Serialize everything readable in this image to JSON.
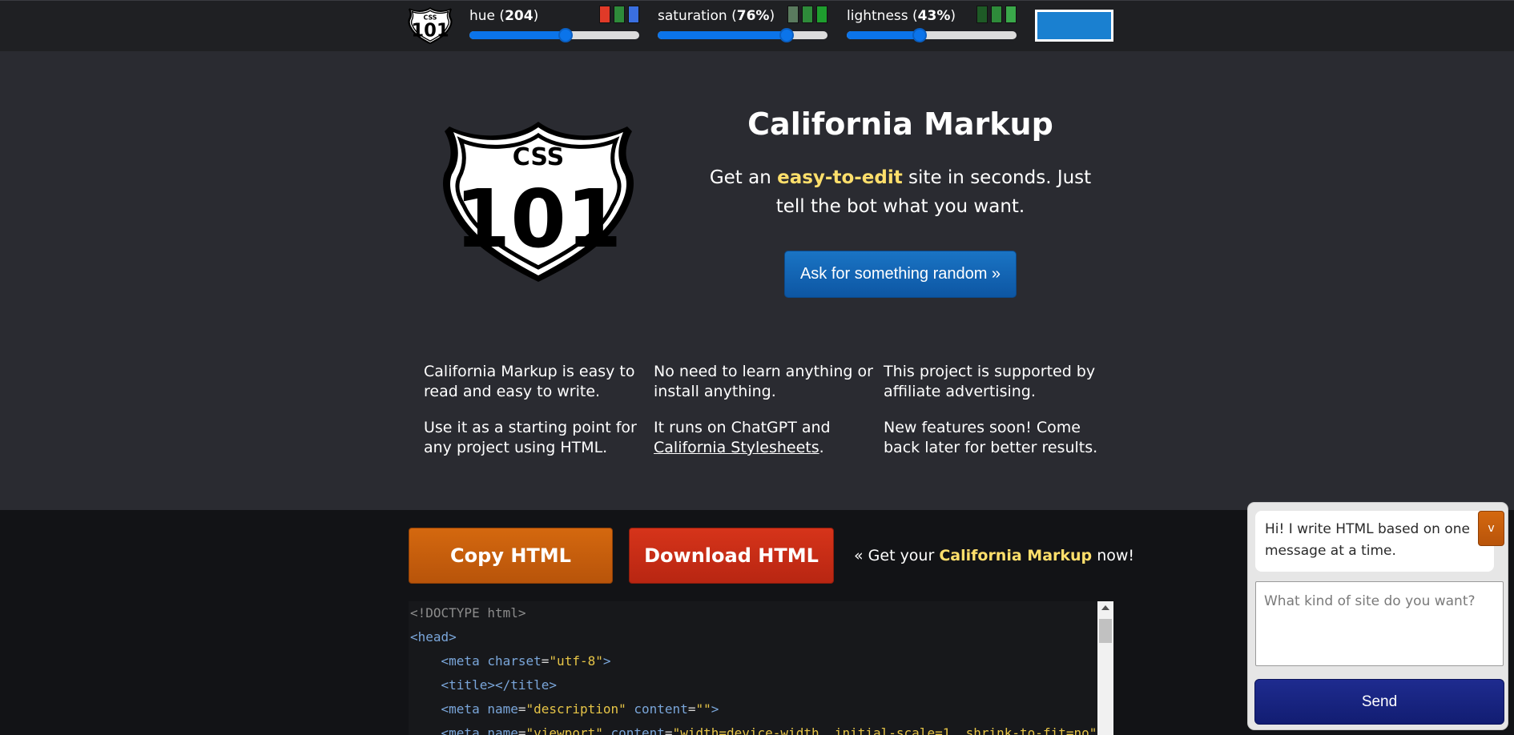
{
  "logo": {
    "top_text": "CSS",
    "number": "101"
  },
  "controls": {
    "hue": {
      "label": "hue",
      "value_text": "204",
      "fraction": 0.567,
      "swatches": [
        "#e03a28",
        "#2e8b3a",
        "#3a6fe0"
      ]
    },
    "saturation": {
      "label": "saturation",
      "value_text": "76%",
      "fraction": 0.76,
      "swatches": [
        "#5a7a5e",
        "#2e8b3a",
        "#1e9e2e"
      ]
    },
    "lightness": {
      "label": "lightness",
      "value_text": "43%",
      "fraction": 0.43,
      "swatches": [
        "#1e5a26",
        "#2e8b3a",
        "#3aa84a"
      ]
    },
    "preview_color": "#1a80d0"
  },
  "hero": {
    "title": "California Markup",
    "subtitle_before": "Get an ",
    "subtitle_highlight": "easy-to-edit",
    "subtitle_after": " site in seconds. Just tell the bot what you want.",
    "random_button": "Ask for something random »"
  },
  "features": [
    {
      "p1": "California Markup is easy to read and easy to write.",
      "p2": "Use it as a starting point for any project using HTML."
    },
    {
      "p1": "No need to learn anything or install anything.",
      "p2_before": "It runs on ChatGPT and ",
      "p2_link": "California Stylesheets",
      "p2_after": "."
    },
    {
      "p1": "This project is supported by affiliate advertising.",
      "p2": "New features soon! Come back later for better results."
    }
  ],
  "actions": {
    "copy": "Copy HTML",
    "download": "Download HTML",
    "get_before": "« Get your ",
    "get_highlight": "California Markup",
    "get_after": " now!"
  },
  "code": {
    "doctype": "<!DOCTYPE html>",
    "head_open": "<head>",
    "meta_charset_attr": "charset",
    "meta_charset_val": "\"utf-8\"",
    "title_tags": "<title></title>",
    "meta_desc_name": "\"description\"",
    "meta_desc_content": "\"\"",
    "meta_viewport_name": "\"viewport\"",
    "meta_viewport_content": "\"width=device-width, initial-scale=1, shrink-to-fit=no\""
  },
  "chat": {
    "toggle_label": "v",
    "bot_message": "Hi! I write HTML based on one message at a time.",
    "input_placeholder": "What kind of site do you want?",
    "send_label": "Send"
  },
  "colors": {
    "accent_yellow": "#ffdf6b",
    "topbar_bg": "#1f2023",
    "page_bg": "#2a2b31",
    "bottom_bg": "#121316"
  }
}
